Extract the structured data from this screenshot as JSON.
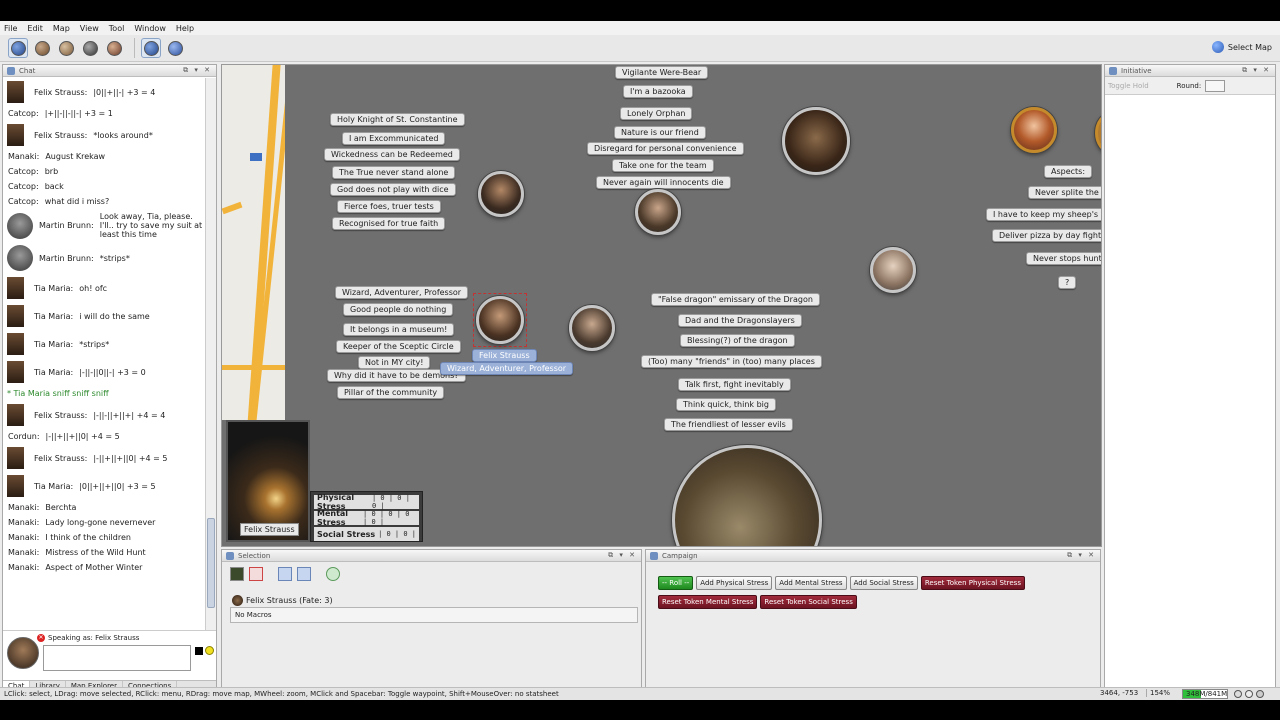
{
  "menu": [
    "File",
    "Edit",
    "Map",
    "View",
    "Tool",
    "Window",
    "Help"
  ],
  "toolbar": {
    "select_map_label": "Select Map"
  },
  "chat": {
    "title": "Chat",
    "messages": [
      {
        "who": "Felix Strauss:",
        "text": "|0||+||-| +3 = 4",
        "avatar": "photo"
      },
      {
        "who": "Catcop:",
        "text": "|+||-||-||-| +3 = 1",
        "avatar": "none"
      },
      {
        "who": "Felix Strauss:",
        "text": "*looks around*",
        "avatar": "photo"
      },
      {
        "who": "Manaki:",
        "text": "August Krekaw",
        "avatar": "none"
      },
      {
        "who": "Catcop:",
        "text": "brb",
        "avatar": "none"
      },
      {
        "who": "Catcop:",
        "text": "back",
        "avatar": "none"
      },
      {
        "who": "Catcop:",
        "text": "what did i miss?",
        "avatar": "none"
      },
      {
        "who": "Martin Brunn:",
        "text": "Look away, Tia, please. I'll.. try to save my suit at least this time",
        "avatar": "round"
      },
      {
        "who": "Martin Brunn:",
        "text": "*strips*",
        "avatar": "round"
      },
      {
        "who": "Tia Maria:",
        "text": "oh! ofc",
        "avatar": "photo"
      },
      {
        "who": "Tia Maria:",
        "text": "i will do the same",
        "avatar": "photo"
      },
      {
        "who": "Tia Maria:",
        "text": "*strips*",
        "avatar": "photo"
      },
      {
        "who": "Tia Maria:",
        "text": "|-||-||0||-| +3 = 0",
        "avatar": "photo"
      },
      {
        "who": "",
        "text": "* Tia Maria sniff sniff sniff",
        "avatar": "emote"
      },
      {
        "who": "Felix Strauss:",
        "text": "|-||-||+||+| +4 = 4",
        "avatar": "photo"
      },
      {
        "who": "Cordun:",
        "text": "|-||+||+||0| +4 = 5",
        "avatar": "none"
      },
      {
        "who": "Felix Strauss:",
        "text": "|-||+||+||0| +4 = 5",
        "avatar": "photo"
      },
      {
        "who": "Tia Maria:",
        "text": "|0||+||+||0| +3 = 5",
        "avatar": "photo"
      },
      {
        "who": "Manaki:",
        "text": "Berchta",
        "avatar": "none"
      },
      {
        "who": "Manaki:",
        "text": "Lady long-gone nevernever",
        "avatar": "none"
      },
      {
        "who": "Manaki:",
        "text": "I think of the children",
        "avatar": "none"
      },
      {
        "who": "Manaki:",
        "text": "Mistress of the Wild Hunt",
        "avatar": "none"
      },
      {
        "who": "Manaki:",
        "text": "Aspect of Mother Winter",
        "avatar": "none"
      }
    ],
    "speaking_as": "Speaking as: Felix Strauss",
    "tabs": [
      "Chat",
      "Library",
      "Map Explorer",
      "Connections"
    ]
  },
  "map": {
    "map_labels": {
      "col1": [
        "Holy Knight of St. Constantine",
        "I am Excommunicated",
        "Wickedness can be Redeemed",
        "The True never stand alone",
        "God does not play with dice",
        "Fierce foes, truer tests",
        "Recognised for true faith"
      ],
      "col2": [
        "Vigilante Were-Bear",
        "I'm a bazooka",
        "Lonely Orphan",
        "Nature is our friend",
        "Disregard for personal convenience",
        "Take one for the team",
        "Never again will innocents die"
      ],
      "col3": [
        "Wizard, Adventurer, Professor",
        "Good people do nothing",
        "It belongs in a museum!",
        "Keeper of the Sceptic Circle",
        "Not in MY city!",
        "Why did it have to be demons?",
        "Pillar of the community"
      ],
      "col4": [
        "\"False dragon\" emissary of the Dragon",
        "Dad and the Dragonslayers",
        "Blessing(?) of the dragon",
        "(Too) many \"friends\" in (too) many places",
        "Talk first, fight inevitably",
        "Think quick, think big",
        "The friendliest of lesser evils"
      ],
      "col5": [
        "Aspects:",
        "Never splite the pa",
        "I have to keep my sheep's clot",
        "Deliver pizza by day fight crim",
        "Never stops hunting",
        "?"
      ],
      "selected_name": "Felix Strauss",
      "selected_aspect": "Wizard, Adventurer, Professor"
    },
    "portrait_name": "Felix Strauss",
    "stress": [
      {
        "label": "Physical Stress",
        "value": "| 0 | 0 | 0 |"
      },
      {
        "label": "Mental Stress",
        "value": "| 0 | 0 | 0 | 0 |"
      },
      {
        "label": "Social Stress",
        "value": "| 0 | 0 |"
      }
    ]
  },
  "selection": {
    "title": "Selection",
    "token": "Felix Strauss (Fate: 3)",
    "macros": "No Macros"
  },
  "campaign": {
    "title": "Campaign",
    "buttons": [
      {
        "label": "-- Roll --",
        "style": "green"
      },
      {
        "label": "Add Physical Stress",
        "style": "normal"
      },
      {
        "label": "Add Mental Stress",
        "style": "normal"
      },
      {
        "label": "Add Social Stress",
        "style": "normal"
      },
      {
        "label": "Reset Token Physical Stress",
        "style": "red"
      },
      {
        "label": "Reset Token Mental Stress",
        "style": "red"
      },
      {
        "label": "Reset Token Social Stress",
        "style": "red"
      }
    ]
  },
  "initiative": {
    "title": "Initiative",
    "toggle": "Toggle Hold",
    "round": "Round:"
  },
  "status": {
    "hint": "LClick: select, LDrag: move selected, RClick: menu, RDrag: move map, MWheel: zoom, MClick and Spacebar: Toggle waypoint, Shift+MouseOver: no statsheet",
    "coords": "3464, -753",
    "zoom": "154%",
    "memory": "348M/841M",
    "memory_fraction": 0.41
  },
  "colors": {
    "map_bg": "#6f6f6f",
    "roll_button": "#2a9a2a",
    "reset_button": "#8a1e2e"
  }
}
